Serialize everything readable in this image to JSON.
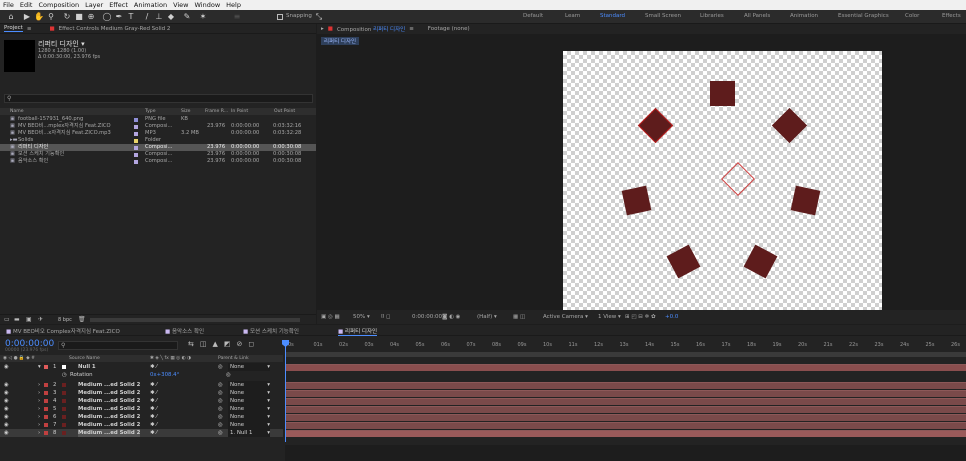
{
  "menu": [
    "File",
    "Edit",
    "Composition",
    "Layer",
    "Effect",
    "Animation",
    "View",
    "Window",
    "Help"
  ],
  "toolbar": {
    "snapping_label": "Snapping"
  },
  "workspaces": [
    {
      "label": "Default",
      "active": false
    },
    {
      "label": "Learn",
      "active": false
    },
    {
      "label": "Standard",
      "active": true
    },
    {
      "label": "Small Screen",
      "active": false
    },
    {
      "label": "Libraries",
      "active": false
    },
    {
      "label": "All Panels",
      "active": false
    },
    {
      "label": "Animation",
      "active": false
    },
    {
      "label": "Essential Graphics",
      "active": false
    },
    {
      "label": "Color",
      "active": false
    },
    {
      "label": "Effects",
      "active": false
    }
  ],
  "project": {
    "tab_label": "Project",
    "effect_controls_label": "Effect Controls Medium Gray-Red Solid 2",
    "comp_name": "리퍼티 디자인",
    "comp_info1": "1280 x 1280 (1.00)",
    "comp_info2": "Δ 0:00:30:00, 23.976 fps",
    "search_placeholder": "",
    "columns": {
      "name": "Name",
      "type": "Type",
      "size": "Size",
      "frame_rate": "Frame R...",
      "in_point": "In Point",
      "out_point": "Out Point"
    },
    "items": [
      {
        "name": "football-157931_640.png",
        "type": "PNG file",
        "size": "KB",
        "fr": "",
        "in": "",
        "out": "",
        "color": "#8f8fd8",
        "selected": false
      },
      {
        "name": "MV BEO비...mplex자격지심 Feat.ZICO",
        "type": "Composi...",
        "size": "",
        "fr": "23.976",
        "in": "0:00:00:00",
        "out": "0:03:32:16",
        "color": "#b3a6e0",
        "selected": false
      },
      {
        "name": "MV BEO비...x자격지심 Feat.ZICO.mp3",
        "type": "MP3",
        "size": "3.2 MB",
        "fr": "",
        "in": "0:00:00:00",
        "out": "0:03:32:28",
        "color": "#b3a6e0",
        "selected": false
      },
      {
        "name": "Solids",
        "type": "Folder",
        "size": "",
        "fr": "",
        "in": "",
        "out": "",
        "color": "#e8d46a",
        "selected": false
      },
      {
        "name": "리퍼티 디자인",
        "type": "Composi...",
        "size": "",
        "fr": "23.976",
        "in": "0:00:00:00",
        "out": "0:00:30:08",
        "color": "#b3a6e0",
        "selected": true
      },
      {
        "name": "모션 스케치 기능확인",
        "type": "Composi...",
        "size": "",
        "fr": "23.976",
        "in": "0:00:00:00",
        "out": "0:00:30:08",
        "color": "#b3a6e0",
        "selected": false
      },
      {
        "name": "음악소스 확인",
        "type": "Composi...",
        "size": "",
        "fr": "23.976",
        "in": "0:00:00:00",
        "out": "0:00:30:08",
        "color": "#b3a6e0",
        "selected": false
      }
    ],
    "bpc_label": "8 bpc"
  },
  "composition": {
    "tab_label": "Composition",
    "comp_name": "리퍼티 디자인",
    "footage_label": "Footage (none)",
    "breadcrumb": "리퍼티 디자인",
    "zoom": "50%",
    "timecode": "0:00:00:00",
    "resolution": "(Half)",
    "camera": "Active Camera",
    "view": "1 View",
    "exposure": "+0.0"
  },
  "timeline": {
    "tabs": [
      {
        "label": "MV BEO비오 Complex자격지심 Feat.ZICO",
        "active": false
      },
      {
        "label": "음악소스 확인",
        "active": false
      },
      {
        "label": "모션 스케치 기능확인",
        "active": false
      },
      {
        "label": "리퍼티 디자인",
        "active": true
      }
    ],
    "timecode": "0:00:00:00",
    "fps_info": "00000 (23.976 fps)",
    "search_placeholder": "",
    "col_source": "Source Name",
    "col_parent": "Parent & Link",
    "ruler": [
      "0s",
      "01s",
      "02s",
      "03s",
      "04s",
      "05s",
      "06s",
      "07s",
      "08s",
      "09s",
      "10s",
      "11s",
      "12s",
      "13s",
      "14s",
      "15s",
      "16s",
      "17s",
      "18s",
      "19s",
      "20s",
      "21s",
      "22s",
      "23s",
      "24s",
      "25s",
      "26s"
    ],
    "layers": [
      {
        "num": "1",
        "name": "Null 1",
        "parent": "None",
        "color": "#e05b5b",
        "null": true
      },
      {
        "num": "",
        "name": "Rotation",
        "parent": "",
        "rot": "0x+308.4°",
        "prop": true
      },
      {
        "num": "2",
        "name": "Medium ...ed Solid 2",
        "parent": "None",
        "color": "#c04040"
      },
      {
        "num": "3",
        "name": "Medium ...ed Solid 2",
        "parent": "None",
        "color": "#c04040"
      },
      {
        "num": "4",
        "name": "Medium ...ed Solid 2",
        "parent": "None",
        "color": "#c04040"
      },
      {
        "num": "5",
        "name": "Medium ...ed Solid 2",
        "parent": "None",
        "color": "#c04040"
      },
      {
        "num": "6",
        "name": "Medium ...ed Solid 2",
        "parent": "None",
        "color": "#c04040"
      },
      {
        "num": "7",
        "name": "Medium ...ed Solid 2",
        "parent": "None",
        "color": "#c04040"
      },
      {
        "num": "8",
        "name": "Medium ...ed Solid 2",
        "parent": "1. Null 1",
        "color": "#c04040",
        "selected": true
      }
    ]
  }
}
